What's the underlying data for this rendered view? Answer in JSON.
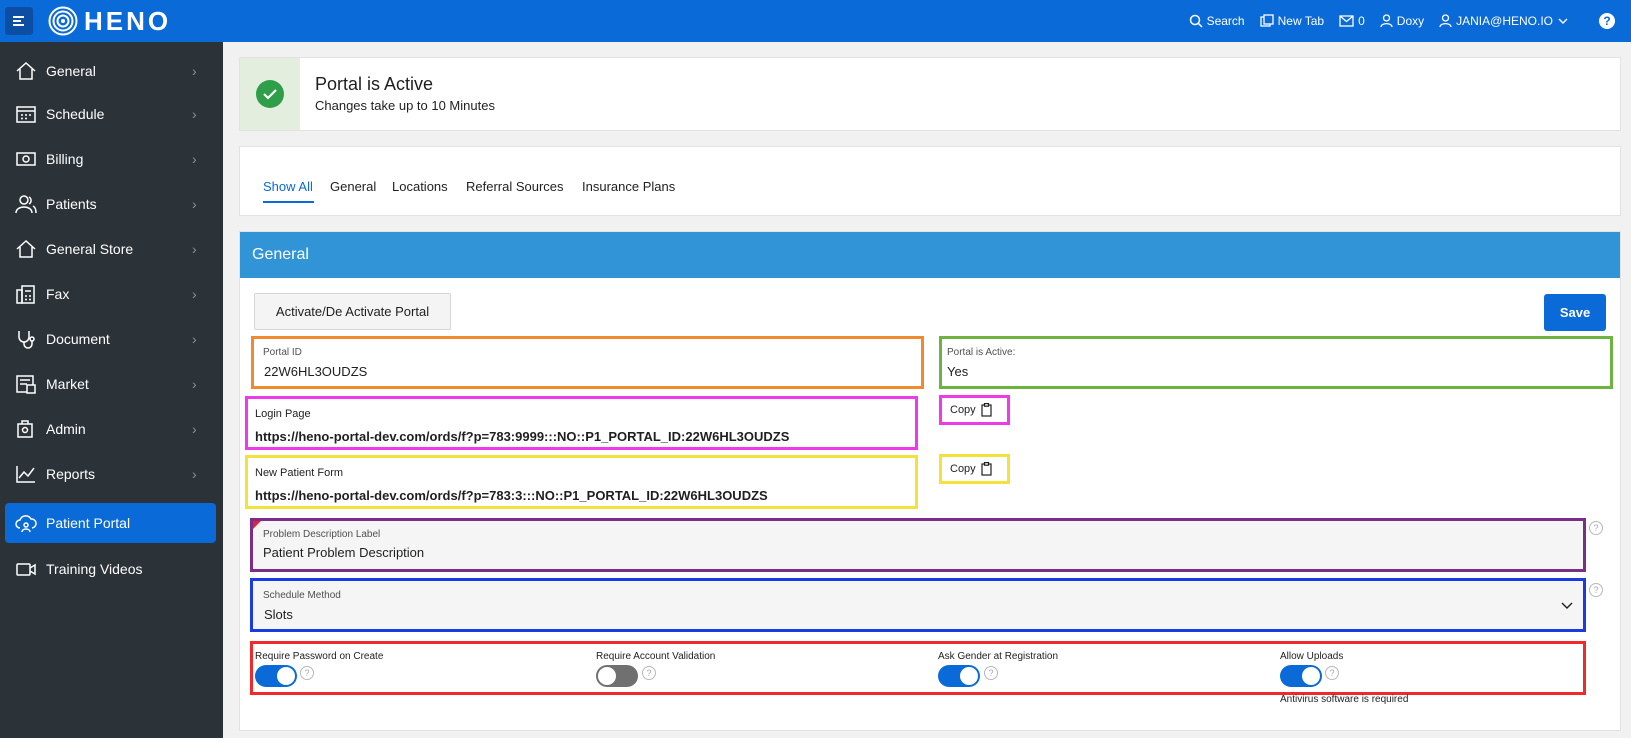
{
  "topbar": {
    "logo_text": "HENO",
    "search": "Search",
    "new_tab": "New Tab",
    "messages_count": "0",
    "doxy": "Doxy",
    "user": "JANIA@HENO.IO",
    "help": "?"
  },
  "sidebar": {
    "items": [
      {
        "label": "General",
        "icon": "home-icon"
      },
      {
        "label": "Schedule",
        "icon": "calendar-icon"
      },
      {
        "label": "Billing",
        "icon": "money-icon"
      },
      {
        "label": "Patients",
        "icon": "users-icon"
      },
      {
        "label": "General Store",
        "icon": "home-icon"
      },
      {
        "label": "Fax",
        "icon": "fax-icon"
      },
      {
        "label": "Document",
        "icon": "stethoscope-icon"
      },
      {
        "label": "Market",
        "icon": "market-icon"
      },
      {
        "label": "Admin",
        "icon": "admin-icon"
      },
      {
        "label": "Reports",
        "icon": "chart-line-icon"
      },
      {
        "label": "Patient Portal",
        "icon": "cloud-user-icon",
        "active": true
      },
      {
        "label": "Training Videos",
        "icon": "video-camera-icon"
      }
    ]
  },
  "alert": {
    "title": "Portal is Active",
    "subtitle": "Changes take up to 10 Minutes"
  },
  "tabs": [
    "Show All",
    "General",
    "Locations",
    "Referral Sources",
    "Insurance Plans"
  ],
  "region": {
    "title": "General",
    "activate_button": "Activate/De Activate Portal",
    "save_button": "Save"
  },
  "fields": {
    "portal_id": {
      "label": "Portal ID",
      "value": "22W6HL3OUDZS"
    },
    "portal_active": {
      "label": "Portal is Active:",
      "value": "Yes"
    },
    "login_page": {
      "label": "Login Page",
      "value": "https://heno-portal-dev.com/ords/f?p=783:9999:::NO::P1_PORTAL_ID:22W6HL3OUDZS"
    },
    "new_patient_form": {
      "label": "New Patient Form",
      "value": "https://heno-portal-dev.com/ords/f?p=783:3:::NO::P1_PORTAL_ID:22W6HL3OUDZS"
    },
    "copy_label": "Copy",
    "problem_description": {
      "label": "Problem Description Label",
      "value": "Patient Problem Description"
    },
    "schedule_method": {
      "label": "Schedule Method",
      "value": "Slots"
    }
  },
  "toggles": [
    {
      "label": "Require Password on Create",
      "on": true
    },
    {
      "label": "Require Account Validation",
      "on": false
    },
    {
      "label": "Ask Gender at Registration",
      "on": true
    },
    {
      "label": "Allow Uploads",
      "on": true,
      "note": "Antivirus software is required"
    }
  ],
  "colors": {
    "topbar": "#0a6ad8",
    "sidebar": "#2b3238",
    "region_header": "#3194d6",
    "success": "#2e9e48"
  }
}
